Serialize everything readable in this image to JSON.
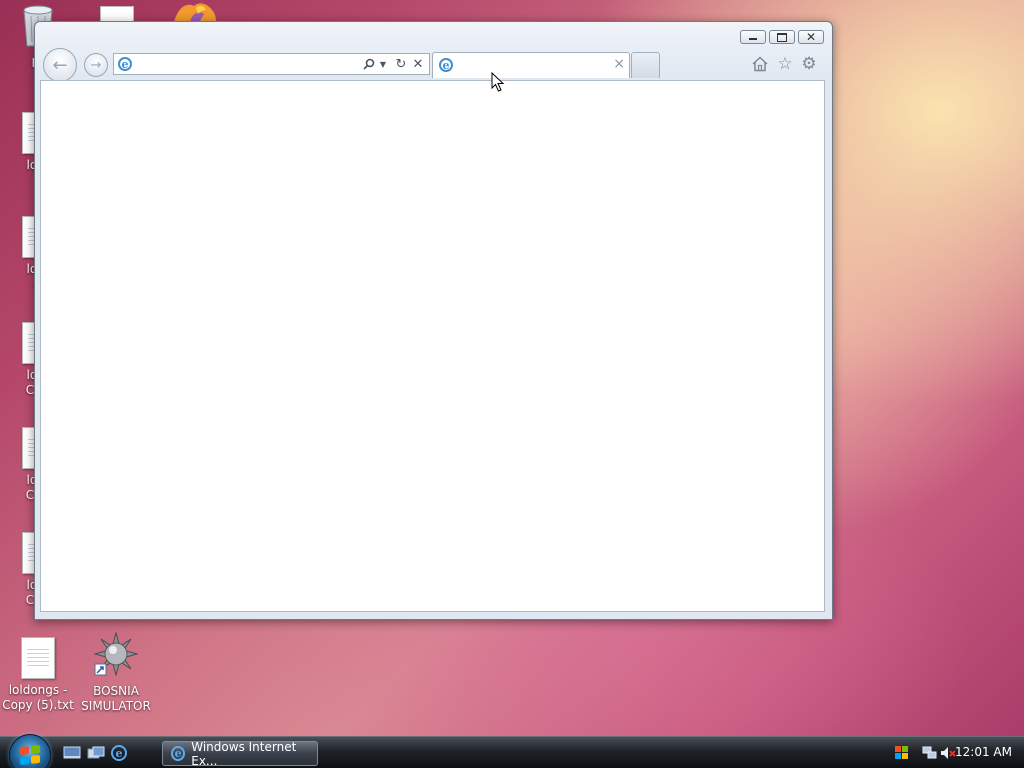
{
  "desktop": {
    "icons": [
      {
        "name": "recycle-bin",
        "label": "Recy"
      },
      {
        "name": "loldongs-file-1",
        "label_lines": [
          "loldo"
        ]
      },
      {
        "name": "loldongs-file-2",
        "label_lines": [
          "loldo",
          "Co"
        ]
      },
      {
        "name": "loldongs-file-3",
        "label_lines": [
          "lolde",
          "Copy"
        ]
      },
      {
        "name": "loldongs-file-4",
        "label_lines": [
          "lolde",
          "Copy"
        ]
      },
      {
        "name": "loldongs-file-5",
        "label_lines": [
          "lolde",
          "Copy"
        ]
      },
      {
        "name": "loldongs-copy-5",
        "label_lines": [
          "loldongs -",
          "Copy (5).txt"
        ]
      },
      {
        "name": "bosnia-simulator",
        "label_lines": [
          "BOSNIA",
          "SIMULATOR"
        ]
      }
    ]
  },
  "browser": {
    "address": {
      "value": "",
      "placeholder": ""
    },
    "tab": {
      "title": "",
      "close_glyph": "×"
    },
    "buttons": {
      "back": "back-arrow-icon",
      "forward": "forward-arrow-icon",
      "search": "search-icon",
      "refresh": "refresh-icon",
      "stop": "stop-icon",
      "home": "home-icon",
      "favorites": "star-icon",
      "tools": "gear-icon"
    },
    "caption": {
      "minimize": "minimize-icon",
      "restore": "restore-icon",
      "close": "close-icon"
    }
  },
  "taskbar": {
    "task_button_label": "Windows Internet Ex...",
    "clock": "12:01 AM"
  },
  "colors": {
    "ie_blue": "#3d8fd6",
    "taskbar_dark": "#1e2227",
    "wallpaper_pink": "#c65a7e",
    "wallpaper_peach": "#f8d8a8"
  }
}
